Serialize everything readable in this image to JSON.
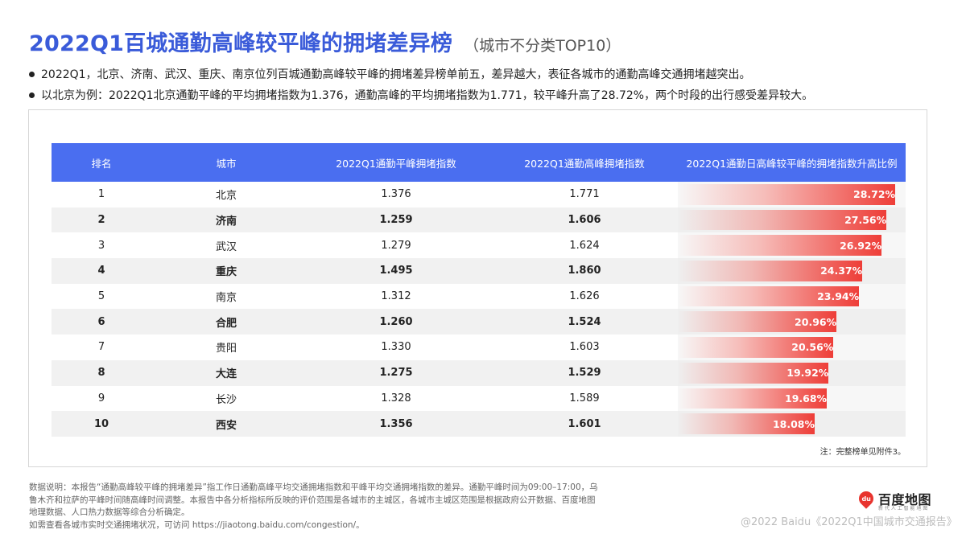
{
  "header": {
    "title": "2022Q1百城通勤高峰较平峰的拥堵差异榜",
    "subtitle": "（城市不分类TOP10）"
  },
  "bullets": [
    "2022Q1，北京、济南、武汉、重庆、南京位列百城通勤高峰较平峰的拥堵差异榜单前五，差异越大，表征各城市的通勤高峰交通拥堵越突出。",
    "以北京为例：2022Q1北京通勤平峰的平均拥堵指数为1.376，通勤高峰的平均拥堵指数为1.771，较平峰升高了28.72%，两个时段的出行感受差异较大。"
  ],
  "table": {
    "columns": [
      "排名",
      "城市",
      "2022Q1通勤平峰拥堵指数",
      "2022Q1通勤高峰拥堵指数",
      "2022Q1通勤日高峰较平峰的拥堵指数升高比例"
    ],
    "rows": [
      {
        "rank": "1",
        "city": "北京",
        "offpeak": "1.376",
        "peak": "1.771",
        "ratio": "28.72%",
        "ratio_value": 28.72
      },
      {
        "rank": "2",
        "city": "济南",
        "offpeak": "1.259",
        "peak": "1.606",
        "ratio": "27.56%",
        "ratio_value": 27.56
      },
      {
        "rank": "3",
        "city": "武汉",
        "offpeak": "1.279",
        "peak": "1.624",
        "ratio": "26.92%",
        "ratio_value": 26.92
      },
      {
        "rank": "4",
        "city": "重庆",
        "offpeak": "1.495",
        "peak": "1.860",
        "ratio": "24.37%",
        "ratio_value": 24.37
      },
      {
        "rank": "5",
        "city": "南京",
        "offpeak": "1.312",
        "peak": "1.626",
        "ratio": "23.94%",
        "ratio_value": 23.94
      },
      {
        "rank": "6",
        "city": "合肥",
        "offpeak": "1.260",
        "peak": "1.524",
        "ratio": "20.96%",
        "ratio_value": 20.96
      },
      {
        "rank": "7",
        "city": "贵阳",
        "offpeak": "1.330",
        "peak": "1.603",
        "ratio": "20.56%",
        "ratio_value": 20.56
      },
      {
        "rank": "8",
        "city": "大连",
        "offpeak": "1.275",
        "peak": "1.529",
        "ratio": "19.92%",
        "ratio_value": 19.92
      },
      {
        "rank": "9",
        "city": "长沙",
        "offpeak": "1.328",
        "peak": "1.589",
        "ratio": "19.68%",
        "ratio_value": 19.68
      },
      {
        "rank": "10",
        "city": "西安",
        "offpeak": "1.356",
        "peak": "1.601",
        "ratio": "18.08%",
        "ratio_value": 18.08
      }
    ],
    "note": "注：完整榜单见附件3。"
  },
  "footer": {
    "lines": [
      "数据说明：本报告“通勤高峰较平峰的拥堵差异”指工作日通勤高峰平均交通拥堵指数和平峰平均交通拥堵指数的差异。通勤平峰时间为09:00–17:00，乌",
      "鲁木齐和拉萨的平峰时间随高峰时间调整。本报告中各分析指标所反映的评价范围是各城市的主城区，各城市主城区范围是根据政府公开数据、百度地图",
      "地理数据、人口热力数据等综合分析确定。",
      "如需查看各城市实时交通拥堵状况，可访问 https://jiaotong.baidu.com/congestion/。"
    ]
  },
  "logo": {
    "mark": "du",
    "name": "百度地图",
    "tagline": "新 代 人 工 智 能 地 图"
  },
  "watermark": "@2022 Baidu《2022Q1中国城市交通报告》",
  "colors": {
    "title": "#3a5bd9",
    "header_bg": "#4a6ef0",
    "bar": "#ee342e",
    "logo": "#e8342e"
  }
}
